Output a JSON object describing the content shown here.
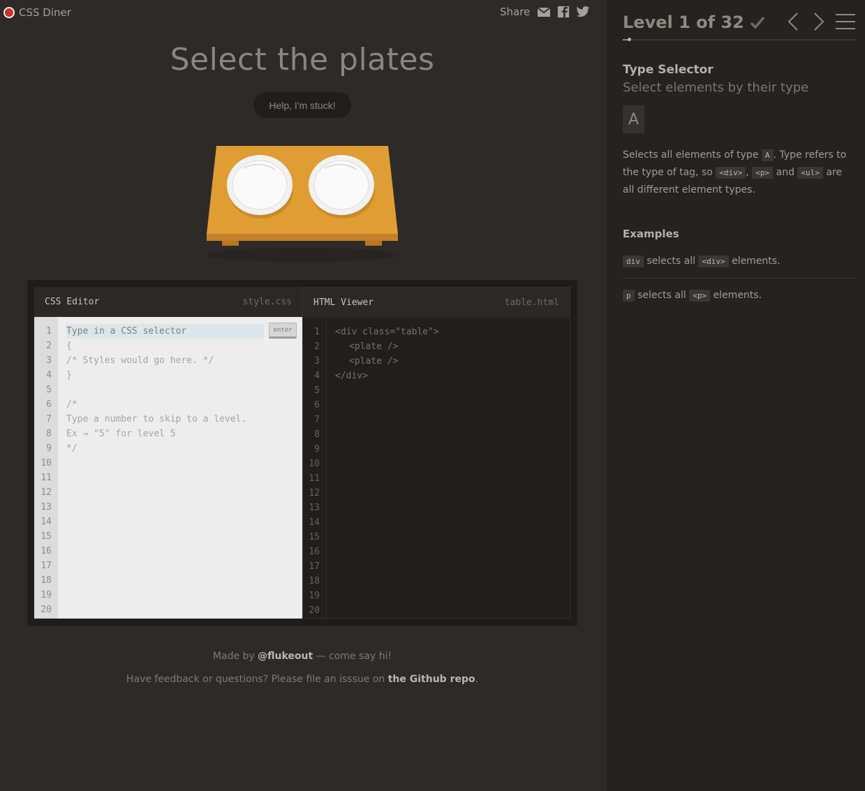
{
  "app": {
    "name": "CSS Diner"
  },
  "share": {
    "label": "Share",
    "icons": [
      "mail-icon",
      "facebook-icon",
      "twitter-icon"
    ]
  },
  "level_title": "Select the plates",
  "help_button": "Help, I'm stuck!",
  "table": {
    "items": [
      "plate",
      "plate"
    ]
  },
  "css_editor": {
    "title": "CSS Editor",
    "file": "style.css",
    "placeholder": "Type in a CSS selector",
    "enter_label": "enter",
    "lines": [
      "",
      "{",
      "/* Styles would go here. */",
      "}",
      "",
      "/*",
      "Type a number to skip to a level.",
      "Ex → \"5\" for level 5",
      "*/",
      "",
      "",
      "",
      "",
      "",
      "",
      "",
      "",
      "",
      "",
      ""
    ],
    "line_numbers": [
      "1",
      "2",
      "3",
      "4",
      "5",
      "6",
      "7",
      "8",
      "9",
      "10",
      "11",
      "12",
      "13",
      "14",
      "15",
      "16",
      "17",
      "18",
      "19",
      "20"
    ]
  },
  "html_viewer": {
    "title": "HTML Viewer",
    "file": "table.html",
    "lines": [
      "<div class=\"table\">",
      "<plate />",
      "<plate />",
      "</div>"
    ],
    "line_numbers": [
      "1",
      "2",
      "3",
      "4",
      "5",
      "6",
      "7",
      "8",
      "9",
      "10",
      "11",
      "12",
      "13",
      "14",
      "15",
      "16",
      "17",
      "18",
      "19",
      "20"
    ]
  },
  "footer": {
    "made_by_prefix": "Made by",
    "author": "@flukeout",
    "made_by_suffix": "— come say hi!",
    "feedback_prefix": "Have feedback or questions? Please file an isssue on",
    "repo_link": "the Github repo",
    "feedback_suffix": "."
  },
  "sidebar": {
    "level_text": "Level 1 of 32",
    "progress": {
      "current": 1,
      "total": 32
    },
    "selector_name": "Type Selector",
    "title": "Select elements by their type",
    "syntax": "A",
    "hint": {
      "p1": "Selects all elements of type",
      "c1": "A",
      "p2": ". Type refers to the type of tag, so",
      "c2": "<div>",
      "p3": ",",
      "c3": "<p>",
      "p4": "and",
      "c4": "<ul>",
      "p5": "are all different element types."
    },
    "examples_title": "Examples",
    "examples": [
      {
        "code": "div",
        "mid": "selects all",
        "tag": "<div>",
        "end": "elements."
      },
      {
        "code": "p",
        "mid": "selects all",
        "tag": "<p>",
        "end": "elements."
      }
    ]
  },
  "colors": {
    "background": "#2d2a27",
    "sidebar": "#252220",
    "table": "#e0a034",
    "logo": "#c8332b"
  }
}
